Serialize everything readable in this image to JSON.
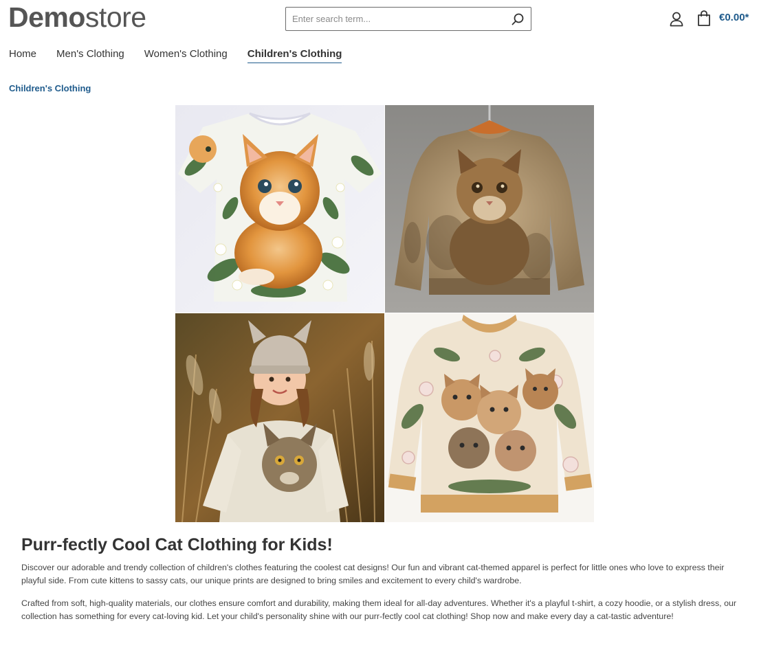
{
  "header": {
    "logo_bold": "Demo",
    "logo_light": "store",
    "search_placeholder": "Enter search term...",
    "cart_total": "€0.00*"
  },
  "nav": {
    "items": [
      {
        "label": "Home"
      },
      {
        "label": "Men's Clothing"
      },
      {
        "label": "Women's Clothing"
      },
      {
        "label": "Children's Clothing"
      }
    ],
    "active": "Children's Clothing"
  },
  "breadcrumb": {
    "current": "Children's Clothing"
  },
  "content": {
    "headline": "Purr-fectly Cool Cat Clothing for Kids!",
    "paragraphs": [
      "Discover our adorable and trendy collection of children's clothes featuring the coolest cat designs! Our fun and vibrant cat-themed apparel is perfect for little ones who love to express their playful side. From cute kittens to sassy cats, our unique prints are designed to bring smiles and excitement to every child's wardrobe.",
      "Crafted from soft, high-quality materials, our clothes ensure comfort and durability, making them ideal for all-day adventures. Whether it's a playful t-shirt, a cozy hoodie, or a stylish dress, our collection has something for every cat-loving kid. Let your child's personality shine with our purr-fectly cool cat clothing! Shop now and make every day a cat-tastic adventure!"
    ]
  },
  "colors": {
    "accent": "#1f5b8c",
    "text": "#333333",
    "logo": "#555555"
  },
  "icons": {
    "search": "search-icon",
    "account": "user-icon",
    "cart": "shopping-bag-icon"
  }
}
